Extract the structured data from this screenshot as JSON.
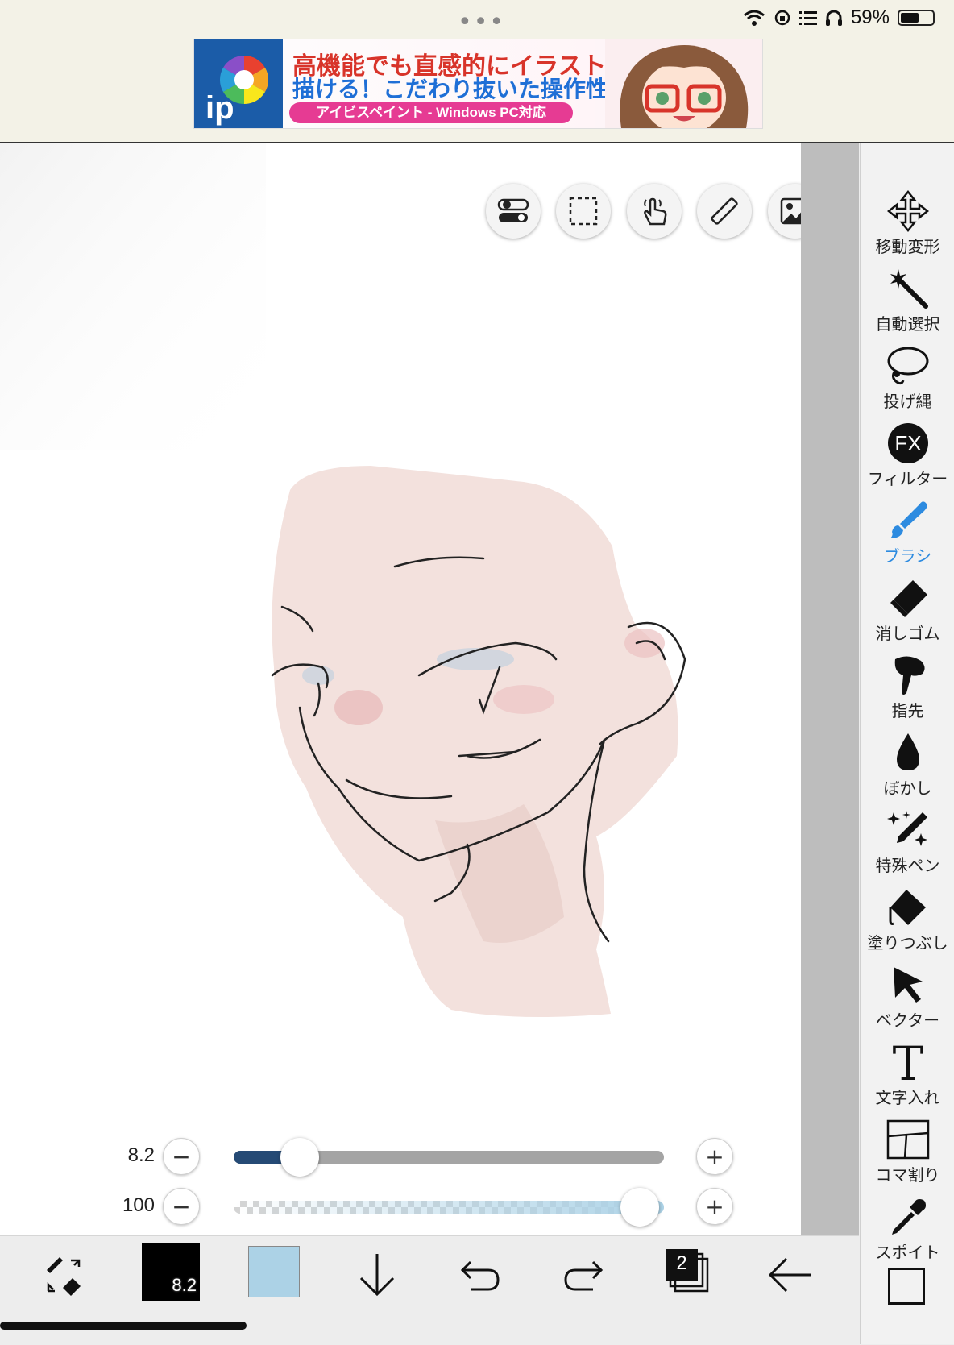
{
  "status_bar": {
    "dots": "•••",
    "battery_text": "59%",
    "battery_level": 0.59
  },
  "ad": {
    "line1": "高機能でも直感的にイラストが",
    "line2": "描ける！こだわり抜いた操作性！",
    "pill": "アイビスペイント - Windows PC対応",
    "logo_text": "ip"
  },
  "canvas_tools": [
    {
      "name": "toggle-icon"
    },
    {
      "name": "selection-rect-icon"
    },
    {
      "name": "hand-touch-icon"
    },
    {
      "name": "ruler-icon"
    },
    {
      "name": "image-icon"
    }
  ],
  "right_toolbar": {
    "tools": [
      {
        "label": "移動変形",
        "icon": "move-transform-icon"
      },
      {
        "label": "自動選択",
        "icon": "magic-wand-icon"
      },
      {
        "label": "投げ縄",
        "icon": "lasso-icon"
      },
      {
        "label": "フィルター",
        "icon": "filter-fx-icon",
        "icon_text": "FX"
      },
      {
        "label": "ブラシ",
        "icon": "brush-icon",
        "active": true
      },
      {
        "label": "消しゴム",
        "icon": "eraser-icon"
      },
      {
        "label": "指先",
        "icon": "finger-smudge-icon"
      },
      {
        "label": "ぼかし",
        "icon": "blur-drop-icon"
      },
      {
        "label": "特殊ペン",
        "icon": "special-pen-icon"
      },
      {
        "label": "塗りつぶし",
        "icon": "fill-bucket-icon"
      },
      {
        "label": "ベクター",
        "icon": "vector-arrow-icon"
      },
      {
        "label": "文字入れ",
        "icon": "text-t-icon",
        "icon_text": "T"
      },
      {
        "label": "コマ割り",
        "icon": "frame-divider-icon"
      },
      {
        "label": "スポイト",
        "icon": "eyedropper-icon"
      }
    ],
    "active_color": "#2d8be0"
  },
  "sliders": {
    "size": {
      "value": "8.2",
      "fraction": 0.12
    },
    "opacity": {
      "value": "100",
      "fraction": 1.0
    },
    "minus": "−",
    "plus": "+"
  },
  "bottom_bar": {
    "brush_size_label": "8.2",
    "primary_color": "#000000",
    "secondary_color": "#acd2e6",
    "layer_count": "2"
  }
}
